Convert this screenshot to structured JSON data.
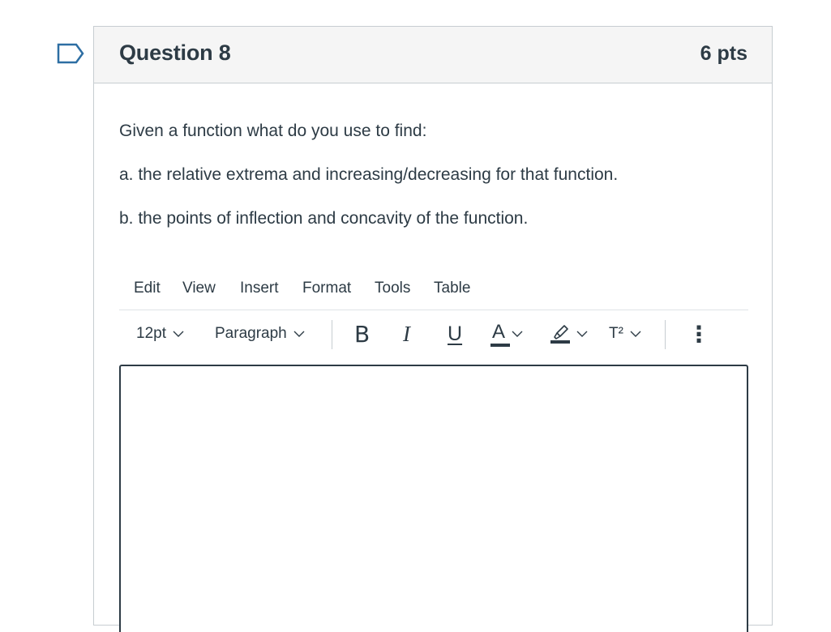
{
  "question": {
    "title": "Question 8",
    "points": "6 pts",
    "lines": [
      "Given a function what do you use to find:",
      "a.  the relative extrema and increasing/decreasing for that function.",
      "b. the points of inflection and concavity of the function."
    ]
  },
  "editor": {
    "menu": [
      "Edit",
      "View",
      "Insert",
      "Format",
      "Tools",
      "Table"
    ],
    "font_size": "12pt",
    "block_format": "Paragraph",
    "buttons": {
      "bold": "B",
      "italic": "I",
      "underline": "U",
      "text_color": "A",
      "superscript": "T²",
      "more": "⋮"
    },
    "content": ""
  },
  "colors": {
    "text": "#2d3b45",
    "border": "#c7cdd1",
    "header_bg": "#f5f5f5"
  }
}
